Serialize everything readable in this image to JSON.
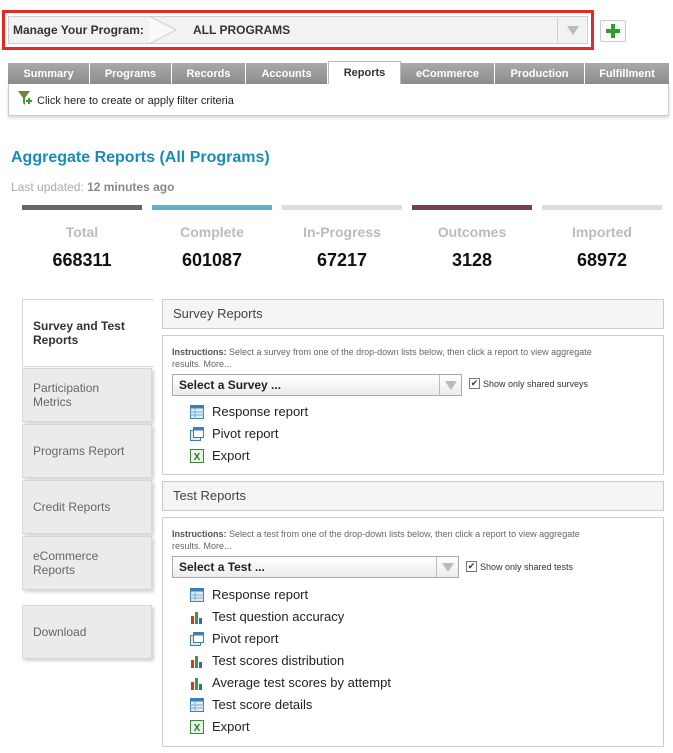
{
  "program": {
    "label": "Manage Your Program:",
    "value": "ALL PROGRAMS"
  },
  "tabs": [
    "Summary",
    "Programs",
    "Records",
    "Accounts",
    "Reports",
    "eCommerce",
    "Production",
    "Fulfillment"
  ],
  "active_tab": "Reports",
  "filter": {
    "text": "Click here to create or apply filter criteria"
  },
  "title": "Aggregate Reports (All Programs)",
  "last_updated": {
    "prefix": "Last updated:",
    "value": "12 minutes ago"
  },
  "stats": [
    {
      "label": "Total",
      "value": "668311",
      "color": "#666666"
    },
    {
      "label": "Complete",
      "value": "601087",
      "color": "#5ab5c9"
    },
    {
      "label": "In-Progress",
      "value": "67217",
      "color": "#dddddd"
    },
    {
      "label": "Outcomes",
      "value": "3128",
      "color": "#7c3b52"
    },
    {
      "label": "Imported",
      "value": "68972",
      "color": "#dddddd"
    }
  ],
  "sidebar": [
    "Survey and Test Reports",
    "Participation Metrics",
    "Programs Report",
    "Credit Reports",
    "eCommerce Reports",
    "Download"
  ],
  "survey": {
    "heading": "Survey Reports",
    "instr_label": "Instructions:",
    "instr_text": " Select a survey from one of the drop-down lists below, then click a report to view aggregate results. More...",
    "select": "Select a Survey ...",
    "checkbox": "Show only shared surveys",
    "links": [
      "Response report",
      "Pivot report",
      "Export"
    ]
  },
  "test": {
    "heading": "Test Reports",
    "instr_label": "Instructions:",
    "instr_text": " Select a test from one of the drop-down lists below, then click a report to view aggregate results. More...",
    "select": "Select a Test ...",
    "checkbox": "Show only shared tests",
    "links": [
      "Response report",
      "Test question accuracy",
      "Pivot report",
      "Test scores distribution",
      "Average test scores by attempt",
      "Test score details",
      "Export"
    ]
  },
  "icons": {
    "table": "table-icon",
    "chart": "bar-chart-icon",
    "pivot": "pivot-icon",
    "excel": "excel-icon"
  }
}
